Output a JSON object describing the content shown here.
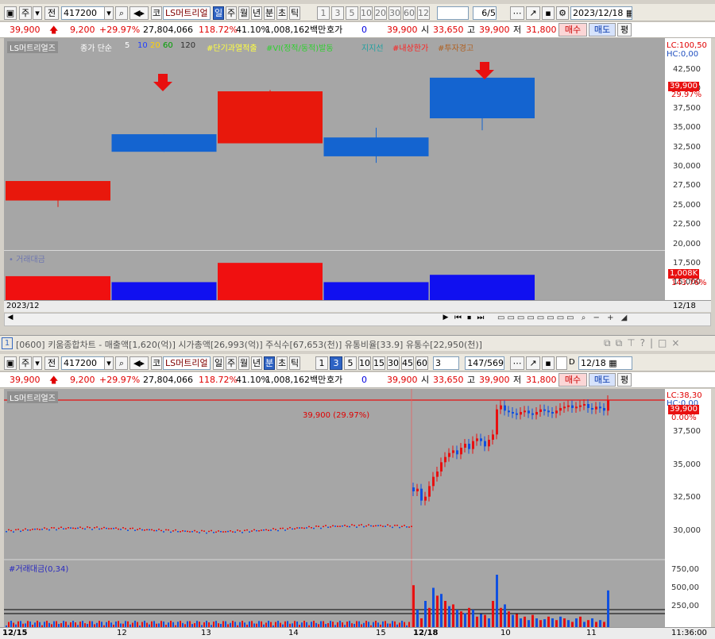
{
  "top": {
    "toolbar": {
      "mode": "주",
      "prev_label": "전",
      "code": "417200",
      "market": "코",
      "stock_name": "LS머트리얼",
      "periods": [
        "일",
        "주",
        "월",
        "년",
        "분",
        "초",
        "틱"
      ],
      "active_period": "일",
      "intervals": [
        "1",
        "3",
        "5",
        "10",
        "20",
        "30",
        "60",
        "120"
      ],
      "page": "6",
      "page_total": "/5",
      "date": "2023/12/18"
    },
    "info": {
      "price": "39,900",
      "change": "9,200",
      "change_pct": "+29.97%",
      "volume": "27,804,066",
      "vol_ratio": "118.72%",
      "turnover": "41.10%",
      "amount": "1,008,162백만",
      "quote_label": "호가",
      "quote_val": "0",
      "quote_price": "39,900",
      "open_label": "시",
      "open": "33,650",
      "high_label": "고",
      "high": "39,900",
      "low_label": "저",
      "low": "31,800",
      "buy": "매수",
      "sell": "매도",
      "eval": "평"
    },
    "legend": {
      "name": "LS머트리얼즈",
      "ma_label": "종가 단순",
      "ma": [
        "5",
        "10",
        "20",
        "60",
        "120"
      ],
      "items": [
        "#단기과열적출",
        "#VI(정적/동적)발동",
        "지지선",
        "#내상한가",
        "#투자경고"
      ]
    },
    "axis": {
      "lc": "LC:100,50",
      "hc": "HC:0,00",
      "ticks": [
        "42,500",
        "40,000",
        "37,500",
        "35,000",
        "32,500",
        "30,000",
        "27,500",
        "25,000",
        "22,500",
        "20,000",
        "17,500",
        "15,000"
      ],
      "price_tag": "39,900",
      "pct_tag": "29.97%"
    },
    "volume": {
      "title": "거래대금",
      "tag": "1,008K",
      "pct": "143.76%"
    },
    "footer": {
      "date": "2023/12",
      "right": "12/18"
    }
  },
  "bottom": {
    "title_bar": "[0600] 키움종합차트 - 매출액[1,620(억)] 시가총액[26,993(억)] 주식수[67,653(천)] 유통비율[33.9] 유통수[22,950(천)]",
    "window_no": "1",
    "toolbar": {
      "mode": "주",
      "prev_label": "전",
      "code": "417200",
      "market": "코",
      "stock_name": "LS머트리얼",
      "periods": [
        "일",
        "주",
        "월",
        "년",
        "분",
        "초",
        "틱"
      ],
      "active_period": "분",
      "intervals": [
        "1",
        "3",
        "5",
        "10",
        "15",
        "30",
        "45",
        "60"
      ],
      "active_interval": "3",
      "interval_select": "3",
      "page": "147",
      "page_total": "/569",
      "d_label": "D",
      "date": "12/18"
    },
    "info": {
      "price": "39,900",
      "change": "9,200",
      "change_pct": "+29.97%",
      "volume": "27,804,066",
      "vol_ratio": "118.72%",
      "turnover": "41.10%",
      "amount": "1,008,162백만",
      "quote_label": "호가",
      "quote_val": "0",
      "quote_price": "39,900",
      "open_label": "시",
      "open": "33,650",
      "high_label": "고",
      "high": "39,900",
      "low_label": "저",
      "low": "31,800",
      "buy": "매수",
      "sell": "매도",
      "eval": "평"
    },
    "legend": {
      "name": "LS머트리얼즈"
    },
    "line_label": "39,900 (29.97%)",
    "axis": {
      "lc": "LC:38,30",
      "hc": "HC:0,00",
      "price_tag": "39,900",
      "pct_tag": "0.00%",
      "ticks": [
        "37,500",
        "35,000",
        "32,500",
        "30,000"
      ]
    },
    "volume": {
      "title": "#거래대금(0,34)",
      "ticks": [
        "750,00",
        "500,00",
        "250,00"
      ]
    },
    "x_labels": [
      "12/15",
      "12",
      "13",
      "14",
      "15",
      "12/18",
      "10",
      "11"
    ],
    "time": "11:36:00"
  },
  "chart_data": [
    {
      "type": "candlestick",
      "title": "",
      "x": [
        "1",
        "2",
        "3",
        "4",
        "5"
      ],
      "ohlc": [
        [
          21000,
          24000,
          20000,
          24000
        ],
        [
          31200,
          31200,
          28500,
          28500
        ],
        [
          29800,
          38000,
          29800,
          37800
        ],
        [
          30700,
          32200,
          26800,
          27800
        ],
        [
          39900,
          39900,
          31800,
          33650
        ]
      ],
      "ylim": [
        13500,
        45500
      ]
    },
    {
      "type": "bar",
      "title": "거래대금",
      "values": [
        520,
        390,
        810,
        390,
        550
      ]
    },
    {
      "type": "candlestick",
      "title": "",
      "ylim": [
        28000,
        39900
      ],
      "prices_summary": {
        "open": 33650,
        "high": 39900,
        "low": 31800,
        "close": 39900
      }
    }
  ]
}
